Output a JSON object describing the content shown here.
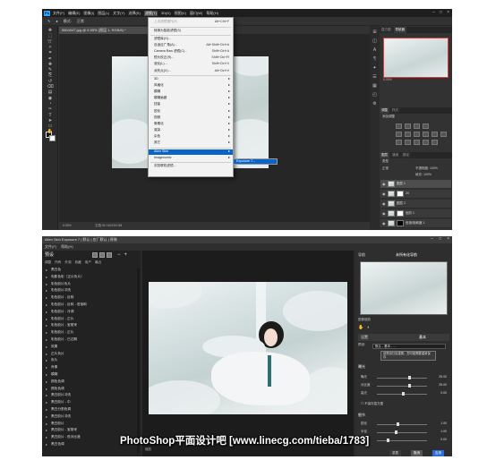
{
  "photoshop": {
    "logo": "Ps",
    "menubar": [
      "文件(F)",
      "编辑(E)",
      "图像(I)",
      "图层(L)",
      "文字(Y)",
      "选择(S)",
      "滤镜(T)",
      "3D(D)",
      "视图(V)",
      "窗口(W)",
      "帮助(H)"
    ],
    "active_menu": "滤镜(T)",
    "options_bar": [
      "模式:",
      "正常"
    ],
    "doc_tab": "5804047.jpg @ 6.55% (图层 1, RGB/8) *",
    "status_zoom": "6.55%",
    "status_doc": "文档:90.1M/290.0M",
    "tool_icons": [
      "move-icon",
      "marquee-icon",
      "lasso-icon",
      "quick-select-icon",
      "crop-icon",
      "eyedropper-icon",
      "healing-icon",
      "brush-icon",
      "stamp-icon",
      "history-brush-icon",
      "eraser-icon",
      "gradient-icon",
      "blur-icon",
      "dodge-icon",
      "pen-icon",
      "text-icon",
      "path-select-icon",
      "shape-icon",
      "hand-icon",
      "zoom-icon"
    ],
    "filter_menu": {
      "items": [
        {
          "label": "上次滤镜操作(F)",
          "shortcut": "Alt+Ctrl+F",
          "disabled": true
        },
        {
          "label": "转换为智能滤镜(S)",
          "shortcut": ""
        },
        {
          "label": "滤镜库(G)...",
          "shortcut": ""
        },
        {
          "label": "自适应广角(A)...",
          "shortcut": "Alt+Shift+Ctrl+A"
        },
        {
          "label": "Camera Raw 滤镜(C)...",
          "shortcut": "Shift+Ctrl+A"
        },
        {
          "label": "镜头校正(R)...",
          "shortcut": "Shift+Ctrl+R"
        },
        {
          "label": "液化(L)...",
          "shortcut": "Shift+Ctrl+X"
        },
        {
          "label": "消失点(V)...",
          "shortcut": "Alt+Ctrl+V"
        },
        {
          "label": "3D",
          "shortcut": "",
          "sub": true
        },
        {
          "label": "风格化",
          "shortcut": "",
          "sub": true
        },
        {
          "label": "模糊",
          "shortcut": "",
          "sub": true
        },
        {
          "label": "模糊画廊",
          "shortcut": "",
          "sub": true
        },
        {
          "label": "扭曲",
          "shortcut": "",
          "sub": true
        },
        {
          "label": "锐化",
          "shortcut": "",
          "sub": true
        },
        {
          "label": "视频",
          "shortcut": "",
          "sub": true
        },
        {
          "label": "像素化",
          "shortcut": "",
          "sub": true
        },
        {
          "label": "渲染",
          "shortcut": "",
          "sub": true
        },
        {
          "label": "杂色",
          "shortcut": "",
          "sub": true
        },
        {
          "label": "其它",
          "shortcut": "",
          "sub": true
        },
        {
          "label": "Alien Skin",
          "shortcut": "",
          "sub": true,
          "highlighted": true
        },
        {
          "label": "Imagenomic",
          "shortcut": "",
          "sub": true
        },
        {
          "label": "浏览联机滤镜...",
          "shortcut": ""
        }
      ],
      "submenu_item": "Exposure 7..."
    },
    "panels": {
      "nav_tabs": [
        "直方图",
        "导航器"
      ],
      "nav_zoom": "6.55%",
      "adjust_tabs": [
        "调整",
        "样式"
      ],
      "adjust_title": "添加调整",
      "layers_tabs": [
        "图层",
        "通道",
        "路径"
      ],
      "layers_kind": "类型",
      "layers_mode": "正常",
      "layers_opacity": "不透明度: 100%",
      "layers_fill": "填充: 100%",
      "layers": [
        {
          "name": "图层 1",
          "mask": "none",
          "selected": true
        },
        {
          "name": "20",
          "mask": "white"
        },
        {
          "name": "图层 2",
          "mask": "none"
        },
        {
          "name": "色阶 1",
          "mask": "white"
        },
        {
          "name": "色相/饱和度 1",
          "mask": "black"
        }
      ]
    }
  },
  "exposure": {
    "window_title": "Alien Skin Exposure 7 | 默认 | 应厂默认 | 原装",
    "menubar": [
      "文件(F)",
      "帮助(H)"
    ],
    "presets_title": "预设",
    "subtabs": [
      "调整",
      "所有",
      "外观",
      "收藏",
      "用户",
      "最近"
    ],
    "categories": [
      "黑白色",
      "电影色彩（正片负片）",
      "彩色胶片负片",
      "彩色胶片冲洗",
      "彩色胶片 - 反转",
      "彩色胶片 - 反转 - 低饱和",
      "彩色胶片 - 冷调",
      "彩色胶片 - 正片",
      "彩色胶片 - 宝丽来",
      "彩色胶片 - 正片",
      "彩色胶片 - 已过期",
      "效果",
      "正片负片",
      "负片",
      "肖像",
      "模糊",
      "颜色色调",
      "颜色色调",
      "黑白胶片冲洗",
      "黑白胶片 - 中",
      "黑白分割色调",
      "黑白胶片冲洗",
      "黑白胶片",
      "黑白胶片 - 宝丽来",
      "黑白胶片 - 低对比度",
      "黑白色调"
    ],
    "zoom_label": "缩放",
    "center_status": "文档:90.1M/290.0M",
    "nav_label": "导航",
    "nav_title": "未所有化导航",
    "nav_zoom": "图像缩放",
    "settings_label": "设置",
    "settings_title": "基本",
    "preset_label": "预设:",
    "preset_value": "默认 - 基本 - ...",
    "warning": "该预设已经重置，您可能需要重新保存",
    "sections": [
      "曝光",
      "细节"
    ],
    "sliders": [
      {
        "label": "曝光",
        "value": "25.00",
        "pos": 0.62
      },
      {
        "label": "对比度",
        "value": "25.00",
        "pos": 0.62
      },
      {
        "label": "高光",
        "value": "0.00",
        "pos": 0.5
      }
    ],
    "checkbox": "☐ 不保存直方图",
    "detail_sliders": [
      {
        "label": "锐化",
        "value": "1.00",
        "pos": 0.4
      },
      {
        "label": "半径",
        "value": "1.00",
        "pos": 0.35
      },
      {
        "label": "阈值",
        "value": "0.00",
        "pos": 0.2
      }
    ],
    "buttons": {
      "reset": "重置",
      "cancel": "取消",
      "ok": "应用"
    },
    "left_buttons": [
      "应用",
      "重置"
    ]
  },
  "watermark": "PhotoShop平面设计吧 [www.linecg.com/tieba/1783]",
  "colors": {
    "ps_blue": "#31a8ff",
    "highlight": "#0a64c8",
    "apply": "#2c6dd6"
  }
}
